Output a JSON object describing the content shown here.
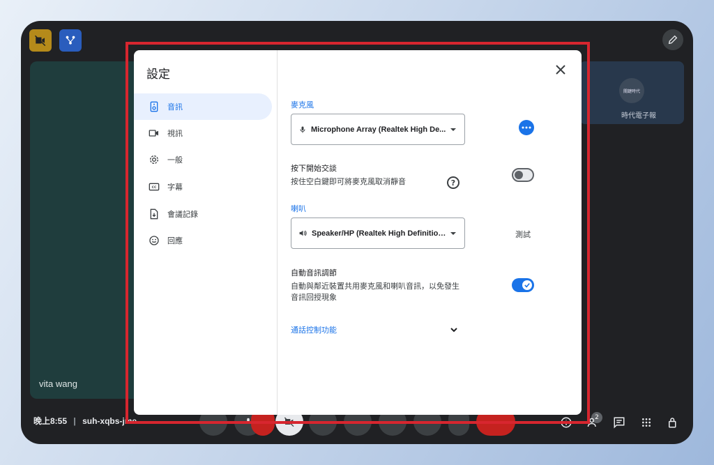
{
  "meeting": {
    "participant_main": "vita wang",
    "participant_side": "時代電子報",
    "side_logo_text": "關鍵時代",
    "time": "晚上8:55",
    "separator": "|",
    "meeting_code": "suh-xqbs-jme",
    "participants_count": "2"
  },
  "settings": {
    "title": "設定",
    "nav": [
      {
        "label": "音訊",
        "icon": "speaker-icon"
      },
      {
        "label": "視訊",
        "icon": "video-icon"
      },
      {
        "label": "一般",
        "icon": "gear-icon"
      },
      {
        "label": "字幕",
        "icon": "captions-icon"
      },
      {
        "label": "會議記錄",
        "icon": "transcript-icon"
      },
      {
        "label": "回應",
        "icon": "smiley-icon"
      }
    ],
    "microphone": {
      "label": "麥克風",
      "value": "Microphone Array (Realtek High De..."
    },
    "push_to_talk": {
      "title": "按下開始交談",
      "desc": "按住空白鍵即可將麥克風取消靜音",
      "enabled": false
    },
    "speaker": {
      "label": "喇叭",
      "value": "Speaker/HP (Realtek High Definition...",
      "test_label": "測試"
    },
    "auto_audio": {
      "title": "自動音訊調節",
      "desc_line1": "自動與鄰近裝置共用麥克風和喇叭音訊，以免發生",
      "desc_line2": "音訊回授現象",
      "enabled": true
    },
    "call_controls": {
      "label": "通話控制功能"
    }
  },
  "colors": {
    "accent": "#1a73e8",
    "outline": "#d7262f",
    "frame": "#202124"
  }
}
